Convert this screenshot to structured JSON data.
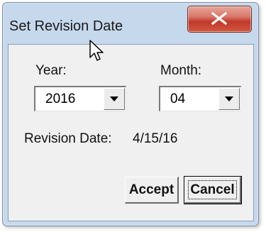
{
  "window": {
    "title": "Set Revision Date",
    "close_icon": "close-x-icon"
  },
  "form": {
    "year_label": "Year:",
    "month_label": "Month:",
    "year_value": "2016",
    "month_value": "04",
    "revision_label": "Revision Date:",
    "revision_value": "4/15/16"
  },
  "buttons": {
    "accept_label": "Accept",
    "cancel_label": "Cancel"
  },
  "colors": {
    "close_button": "#c0392b",
    "frame": "#c6d8ec",
    "client": "#f0f0f0"
  }
}
